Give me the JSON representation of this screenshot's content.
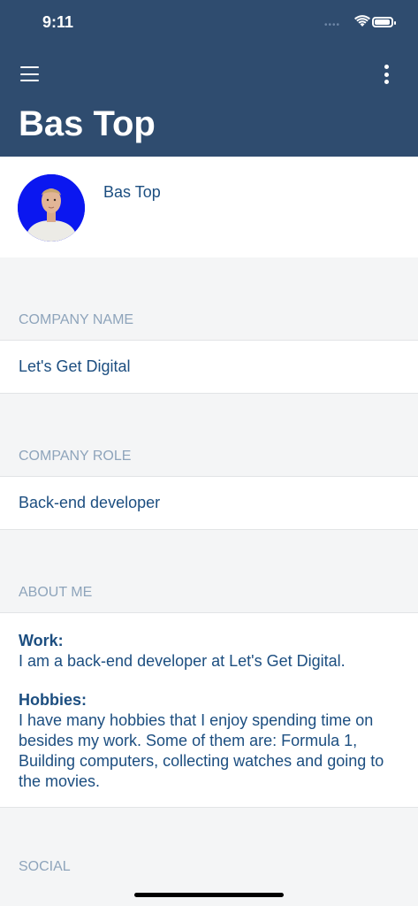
{
  "status_bar": {
    "time": "9:11"
  },
  "header": {
    "title": "Bas Top"
  },
  "profile": {
    "name": "Bas Top"
  },
  "company_name": {
    "header": "COMPANY NAME",
    "value": "Let's Get Digital"
  },
  "company_role": {
    "header": "COMPANY ROLE",
    "value": "Back-end developer"
  },
  "about_me": {
    "header": "ABOUT ME",
    "work_label": "Work:",
    "work_text": "I am a back-end developer at Let's Get Digital.",
    "hobbies_label": "Hobbies:",
    "hobbies_text": "I have many hobbies that I enjoy spending time on besides my work. Some of them are: Formula 1, Building computers, collecting watches and going to the movies."
  },
  "social": {
    "header": "SOCIAL"
  },
  "colors": {
    "header_bg": "#2f4c6f",
    "text_primary": "#1c4e80",
    "section_label": "#8ea4bb",
    "page_bg": "#f4f5f6",
    "avatar_bg": "#0b17f0"
  },
  "icons": {
    "menu": "hamburger-menu-icon",
    "more": "more-vertical-icon",
    "wifi": "wifi-icon",
    "battery": "battery-icon",
    "signal": "cellular-signal-icon"
  }
}
